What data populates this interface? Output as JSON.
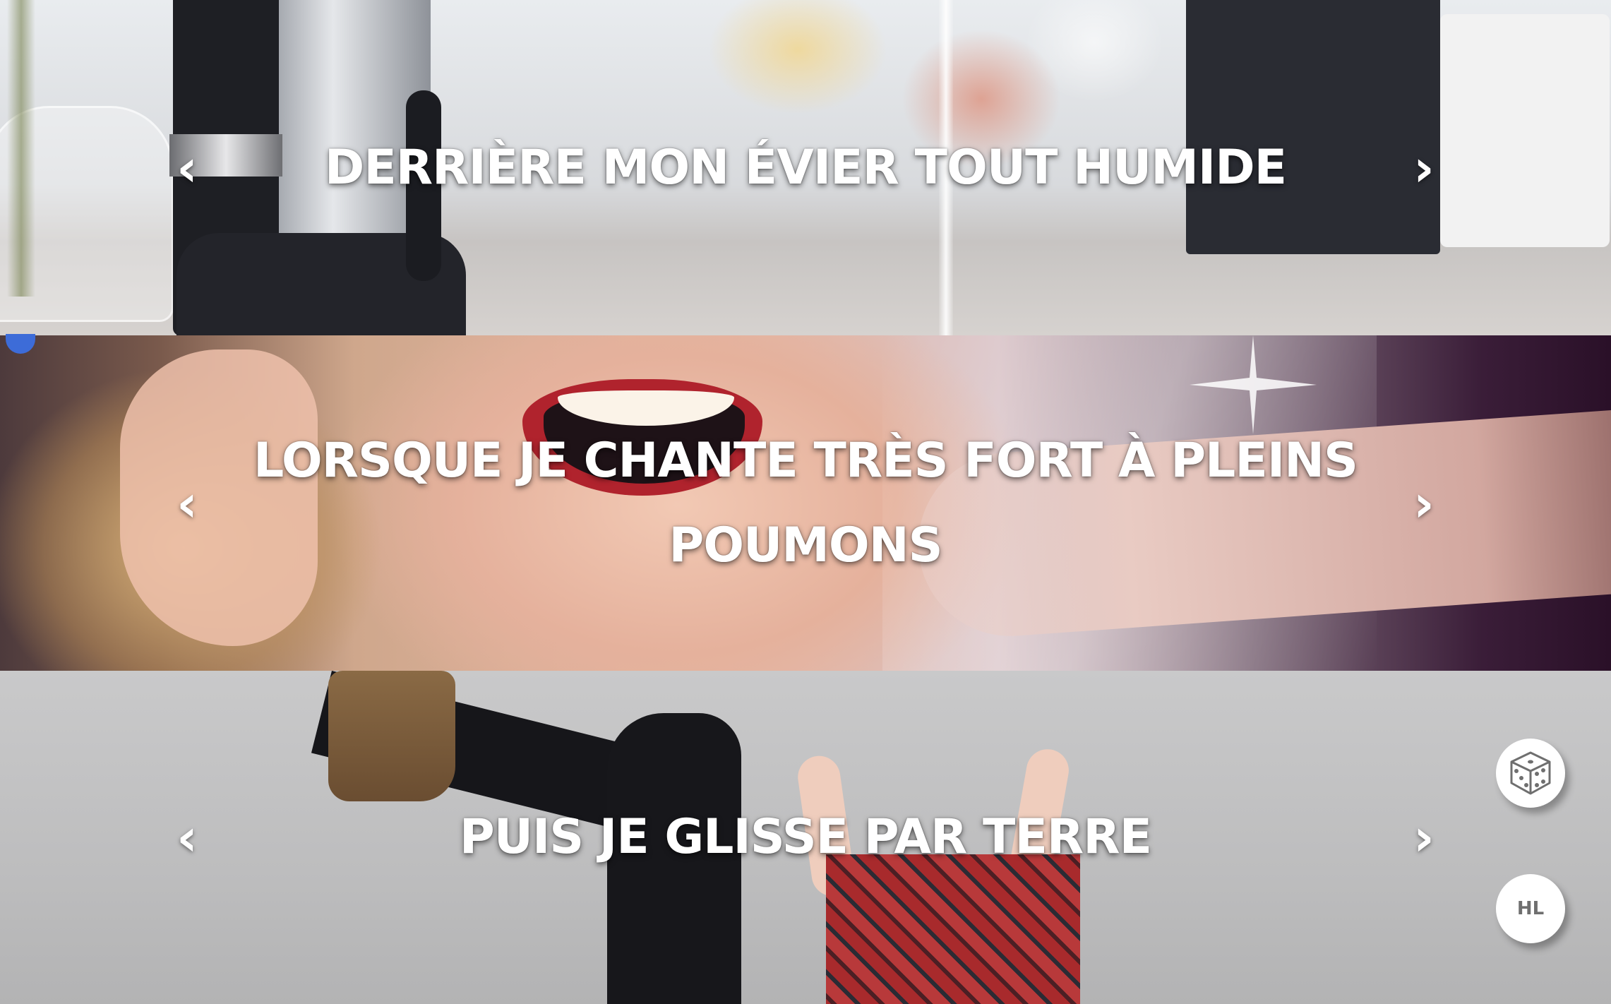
{
  "slides": [
    {
      "caption": "DERRIÈRE MON ÉVIER TOUT HUMIDE",
      "prev_icon": "‹",
      "next_icon": "›"
    },
    {
      "caption": "LORSQUE JE CHANTE TRÈS FORT À PLEINS POUMONS",
      "prev_icon": "‹",
      "next_icon": "›"
    },
    {
      "caption": "PUIS JE GLISSE PAR TERRE",
      "prev_icon": "‹",
      "next_icon": "›"
    }
  ],
  "buttons": {
    "random": {
      "icon": "dice-icon"
    },
    "hl": {
      "label": "HL"
    }
  },
  "colors": {
    "caption_text": "#ffffff",
    "fab_background": "#ffffff",
    "fab_text": "#6f6f6f",
    "accent_dot": "#3d6cd8"
  }
}
